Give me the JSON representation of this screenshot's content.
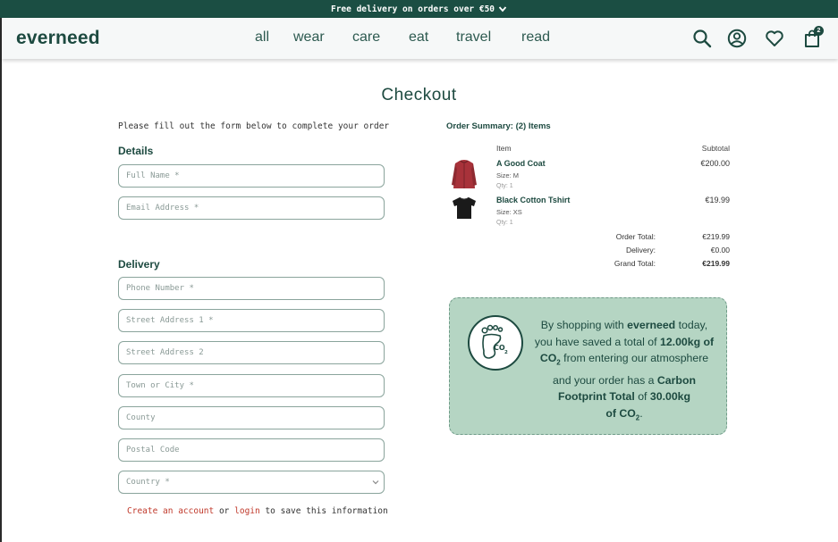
{
  "promo": {
    "text": "Free delivery on orders over €50"
  },
  "header": {
    "logo": "everneed",
    "nav": [
      "all",
      "wear",
      "care",
      "eat",
      "travel",
      "read"
    ],
    "cart_count": "2"
  },
  "page_title": "Checkout",
  "form": {
    "intro": "Please fill out the form below to complete your order",
    "details_heading": "Details",
    "delivery_heading": "Delivery",
    "full_name_placeholder": "Full Name *",
    "email_placeholder": "Email Address *",
    "phone_placeholder": "Phone Number *",
    "street1_placeholder": "Street Address 1 *",
    "street2_placeholder": "Street Address 2",
    "town_placeholder": "Town or City *",
    "county_placeholder": "County",
    "postal_placeholder": "Postal Code",
    "country_selected": "Country *",
    "save_info": {
      "create_link": "Create an account",
      "or": " or ",
      "login_link": "login",
      "suffix": " to save this information"
    }
  },
  "summary": {
    "heading": "Order Summary: (2) Items",
    "col_item": "Item",
    "col_subtotal": "Subtotal",
    "items": [
      {
        "name": "A Good Coat",
        "size": "Size: M",
        "qty": "Qty: 1",
        "price": "€200.00",
        "thumb": "red-coat"
      },
      {
        "name": "Black Cotton Tshirt",
        "size": "Size: XS",
        "qty": "Qty: 1",
        "price": "€19.99",
        "thumb": "black-tshirt"
      }
    ],
    "totals": [
      {
        "label": "Order Total:",
        "value": "€219.99"
      },
      {
        "label": "Delivery:",
        "value": "€0.00"
      },
      {
        "label": "Grand Total:",
        "value": "€219.99"
      }
    ]
  },
  "carbon": {
    "p1": "By shopping with ",
    "brand": "everneed",
    "p2": " today, you have saved a total of ",
    "saved": "12.00kg",
    "of": " of ",
    "co2_a": "CO",
    "sub2_a": "2",
    "p3": " from entering our atmosphere and your order has a ",
    "footprint_label": "Carbon Footprint Total",
    "p4": " of ",
    "footprint_value": "30.00kg",
    "of2": "of ",
    "co2_b": "CO",
    "sub2_b": "2",
    "end": "."
  },
  "colors": {
    "brand_dark": "#1b4e43",
    "carbon_bg": "#b5d5c3",
    "link_red": "#c0392b"
  },
  "icons": [
    "chevron-down-icon",
    "search-icon",
    "account-icon",
    "heart-icon",
    "bag-icon",
    "footprint-co2-icon"
  ]
}
